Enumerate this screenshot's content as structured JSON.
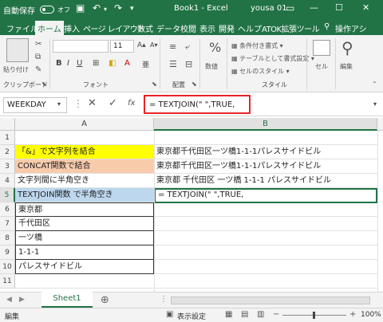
{
  "titlebar": {
    "autosave_label": "自動保存",
    "autosave_state": "オフ",
    "book_title": "Book1 - Excel",
    "user": "yousa 01",
    "accent": "#217346"
  },
  "menu": [
    "ファイル",
    "ホーム",
    "挿入",
    "ページ レイアウト",
    "数式",
    "データ",
    "校閲",
    "表示",
    "開発",
    "ヘルプ",
    "ATOK拡張ツール",
    "操作アシ"
  ],
  "ribbon": {
    "paste_label": "貼り付け",
    "font_size": "11",
    "number_label": "数値",
    "cond_format": "条件付き書式",
    "table_format": "テーブルとして書式設定",
    "cell_style": "セルのスタイル",
    "cells_label": "セル",
    "edit_label": "編集",
    "groups": {
      "clipboard": "クリップボード",
      "font": "フォント",
      "alignment": "配置",
      "style": "スタイル"
    }
  },
  "formula_bar": {
    "name_box": "WEEKDAY",
    "formula": "= TEXTJOIN(\" \",TRUE,",
    "fx": "fx"
  },
  "columns": [
    "A",
    "B"
  ],
  "rows": [
    {
      "n": "1",
      "a": "",
      "b": ""
    },
    {
      "n": "2",
      "a": "「&」で文字列を結合",
      "b": "東京都千代田区一ツ橋1-1-1パレスサイドビル"
    },
    {
      "n": "3",
      "a": "CONCAT関数で結合",
      "b": "東京都千代田区一ツ橋1-1-1パレスサイドビル"
    },
    {
      "n": "4",
      "a": "文字列間に半角空き",
      "b": "東京都 千代田区 一ツ橋 1-1-1 パレスサイドビル"
    },
    {
      "n": "5",
      "a": "TEXTJOIN関数 で半角空き",
      "b": "= TEXTJOIN(\" \",TRUE,"
    },
    {
      "n": "6",
      "a": "東京都",
      "b": ""
    },
    {
      "n": "7",
      "a": "千代田区",
      "b": ""
    },
    {
      "n": "8",
      "a": "一ツ橋",
      "b": ""
    },
    {
      "n": "9",
      "a": "1-1-1",
      "b": ""
    },
    {
      "n": "10",
      "a": "パレスサイドビル",
      "b": ""
    },
    {
      "n": "11",
      "a": "",
      "b": ""
    }
  ],
  "sheet_tab": "Sheet1",
  "status": {
    "mode": "編集",
    "display_settings": "表示設定",
    "zoom": "100%"
  }
}
